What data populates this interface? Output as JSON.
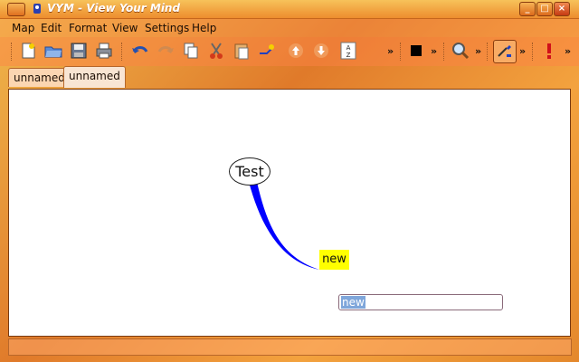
{
  "window": {
    "title": "VYM - View Your Mind",
    "buttons": [
      "minimize",
      "maximize",
      "close"
    ]
  },
  "menubar": {
    "items": [
      {
        "label": "Map",
        "accel": "M"
      },
      {
        "label": "Edit",
        "accel": "E"
      },
      {
        "label": "Format",
        "accel": "F"
      },
      {
        "label": "View",
        "accel": "V"
      },
      {
        "label": "Settings",
        "accel": "S"
      },
      {
        "label": "Help",
        "accel": "H"
      }
    ]
  },
  "toolbar": {
    "items": [
      "new-map-icon",
      "open-icon",
      "save-icon",
      "print-icon",
      "undo-icon",
      "redo-icon",
      "copy-icon",
      "cut-icon",
      "paste-icon",
      "new-branch-icon",
      "move-up-icon",
      "move-down-icon",
      "sort-icon",
      "color-swatch-icon",
      "zoom-icon",
      "pick-color-icon",
      "flag-exclamation-icon"
    ],
    "sort_label": "A Z",
    "overflow": "»"
  },
  "tabs": [
    {
      "label": "unnamed",
      "active": false
    },
    {
      "label": "unnamed",
      "active": true
    }
  ],
  "map": {
    "root": {
      "label": "Test"
    },
    "branch": {
      "label": "new",
      "color": "#ffff00"
    },
    "edit_field": {
      "value": "new"
    },
    "link_color": "#0000ff"
  },
  "colors": {
    "accent": "#e8842e",
    "canvas": "#ffffff",
    "selection": "#7fa6da"
  }
}
